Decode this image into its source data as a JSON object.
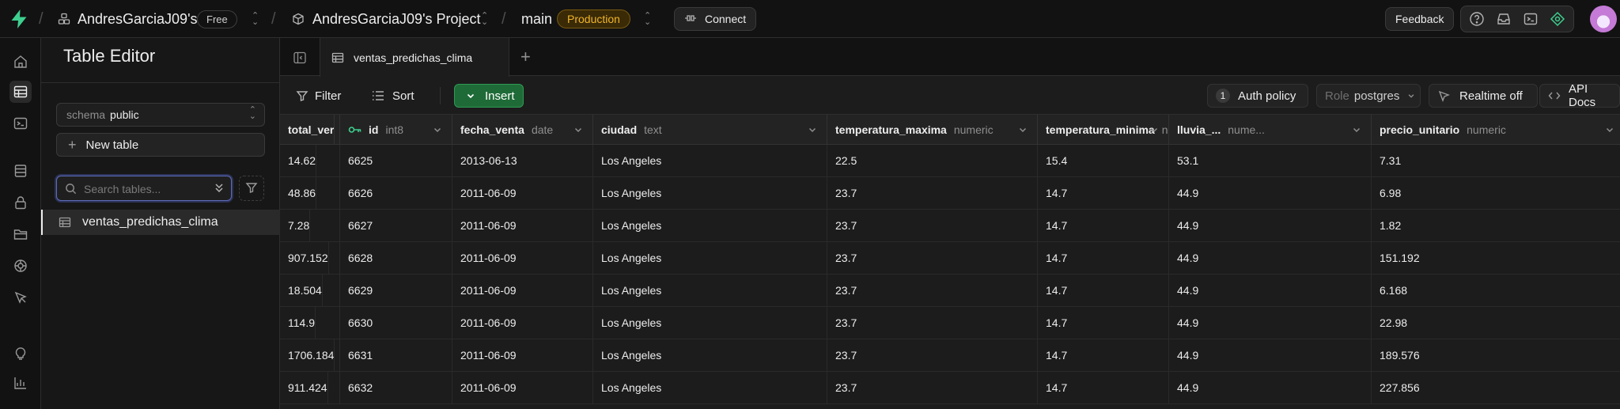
{
  "topbar": {
    "org": "AndresGarciaJ09's",
    "plan": "Free",
    "project": "AndresGarciaJ09's Project",
    "branch": "main",
    "env": "Production",
    "connect": "Connect",
    "feedback": "Feedback"
  },
  "sidebar": {
    "title": "Table Editor",
    "schema_label": "schema",
    "schema_value": "public",
    "new_table": "New table",
    "search_placeholder": "Search tables...",
    "tables": [
      "ventas_predichas_clima"
    ]
  },
  "tab": {
    "label": "ventas_predichas_clima"
  },
  "toolbar": {
    "filter": "Filter",
    "sort": "Sort",
    "insert": "Insert",
    "auth_count": "1",
    "auth_policy": "Auth policy",
    "role_label": "Role",
    "role_value": "postgres",
    "realtime": "Realtime off",
    "api_docs": "API Docs"
  },
  "grid": {
    "columns": [
      {
        "name": "id",
        "type": "int8"
      },
      {
        "name": "fecha_venta",
        "type": "date"
      },
      {
        "name": "ciudad",
        "type": "text"
      },
      {
        "name": "temperatura_maxima",
        "type": "numeric"
      },
      {
        "name": "temperatura_minima",
        "type": "numeric"
      },
      {
        "name": "lluvia_...",
        "type": "nume..."
      },
      {
        "name": "precio_unitario",
        "type": "numeric"
      },
      {
        "name": "total_ver",
        "type": ""
      }
    ],
    "rows": [
      [
        "6625",
        "2013-06-13",
        "Los Angeles",
        "22.5",
        "15.4",
        "53.1",
        "7.31",
        "14.62"
      ],
      [
        "6626",
        "2011-06-09",
        "Los Angeles",
        "23.7",
        "14.7",
        "44.9",
        "6.98",
        "48.86"
      ],
      [
        "6627",
        "2011-06-09",
        "Los Angeles",
        "23.7",
        "14.7",
        "44.9",
        "1.82",
        "7.28"
      ],
      [
        "6628",
        "2011-06-09",
        "Los Angeles",
        "23.7",
        "14.7",
        "44.9",
        "151.192",
        "907.152"
      ],
      [
        "6629",
        "2011-06-09",
        "Los Angeles",
        "23.7",
        "14.7",
        "44.9",
        "6.168",
        "18.504"
      ],
      [
        "6630",
        "2011-06-09",
        "Los Angeles",
        "23.7",
        "14.7",
        "44.9",
        "22.98",
        "114.9"
      ],
      [
        "6631",
        "2011-06-09",
        "Los Angeles",
        "23.7",
        "14.7",
        "44.9",
        "189.576",
        "1706.184"
      ],
      [
        "6632",
        "2011-06-09",
        "Los Angeles",
        "23.7",
        "14.7",
        "44.9",
        "227.856",
        "911.424"
      ]
    ]
  },
  "colors": {
    "accent": "#3ecf8e",
    "production": "#f0b429",
    "insert": "#1f6b37"
  }
}
